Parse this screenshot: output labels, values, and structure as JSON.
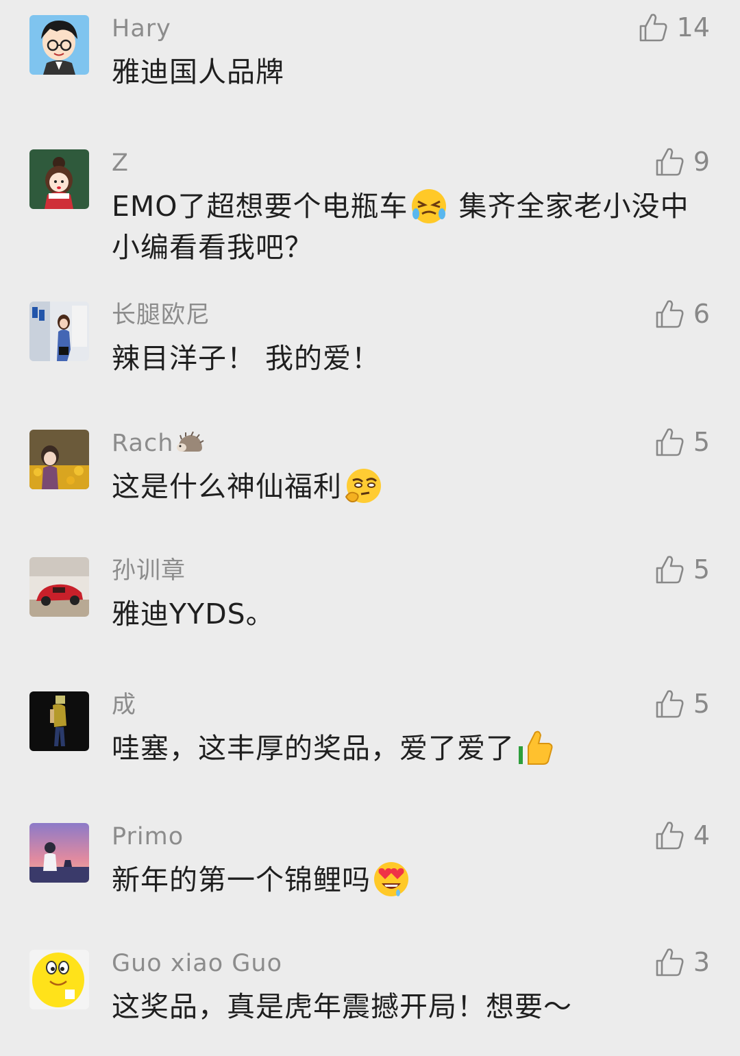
{
  "comments": [
    {
      "name": "Hary",
      "text": "雅迪国人品牌",
      "likes": "14"
    },
    {
      "name": "Z",
      "text_part1": "EMO了超想要个电瓶车",
      "text_part2": " 集齐全家老小没中 小编看看我吧？",
      "likes": "9",
      "emoji": "tears-of-joy-squint-emoji"
    },
    {
      "name": "长腿欧尼",
      "text": "辣目洋子！ 我的爱！",
      "likes": "6"
    },
    {
      "name": "Rach",
      "text": "这是什么神仙福利",
      "likes": "5",
      "name_emoji": "hedgehog-emoji",
      "emoji": "smirk-thinking-emoji"
    },
    {
      "name": "孙训章",
      "text": "雅迪YYDS。",
      "likes": "5"
    },
    {
      "name": "成",
      "text": "哇塞，这丰厚的奖品，爱了爱了",
      "likes": "5",
      "emoji": "thumbs-up-emoji"
    },
    {
      "name": "Primo",
      "text": "新年的第一个锦鲤吗",
      "likes": "4",
      "emoji": "heart-eyes-emoji"
    },
    {
      "name": "Guo xiao Guo",
      "text": "这奖品，真是虎年震撼开局！想要～",
      "likes": "3"
    }
  ],
  "colors": {
    "background": "#ececec",
    "name_text": "#8c8c8c",
    "body_text": "#1f1f1f",
    "like_text": "#888888"
  }
}
